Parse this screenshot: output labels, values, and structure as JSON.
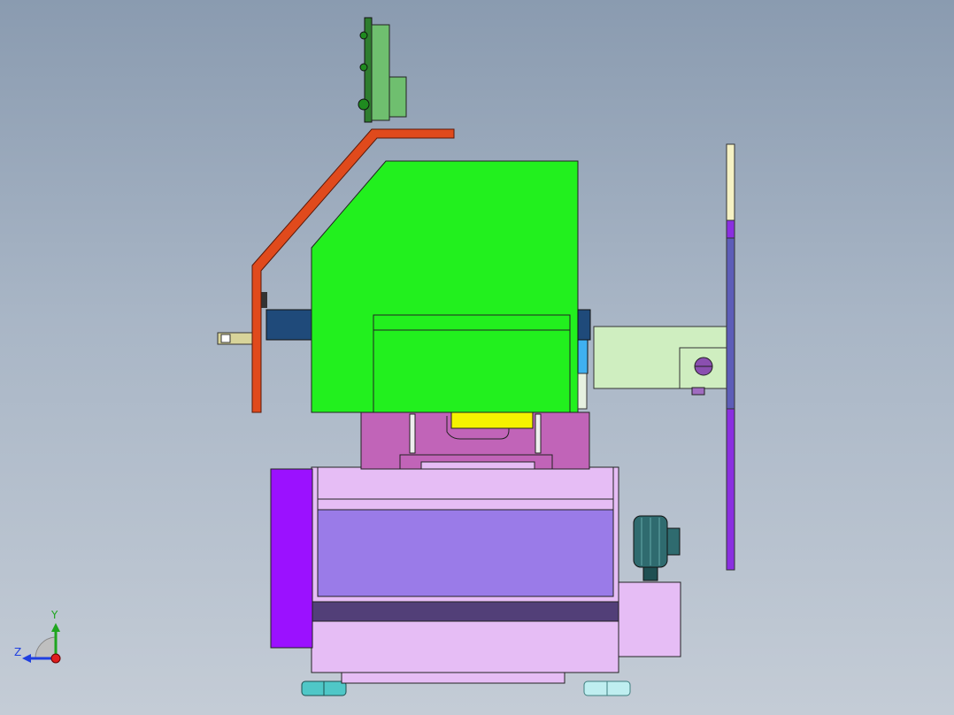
{
  "viewport": {
    "background_top": "#8a9bb0",
    "background_bottom": "#c4ccd6",
    "part_colors": {
      "guard_rail": "#e04a1c",
      "main_housing": "#22f01e",
      "upper_bracket": "#6fbf6f",
      "base_frame": "#e6bdf5",
      "side_panel": "#9b11ff",
      "center_panel": "#9a7be8",
      "column_block": "#c164b8",
      "yellow_block": "#f5f200",
      "right_bracket": "#cfeec0",
      "vertical_rod": "#8a2fe0",
      "motor": "#2f6b6f",
      "feet": "#4fc7c7"
    }
  },
  "triad": {
    "y_label": "Y",
    "z_label": "Z",
    "y_color": "#1fa51f",
    "z_color": "#1f3fe0",
    "origin_color": "#e01e1e"
  }
}
